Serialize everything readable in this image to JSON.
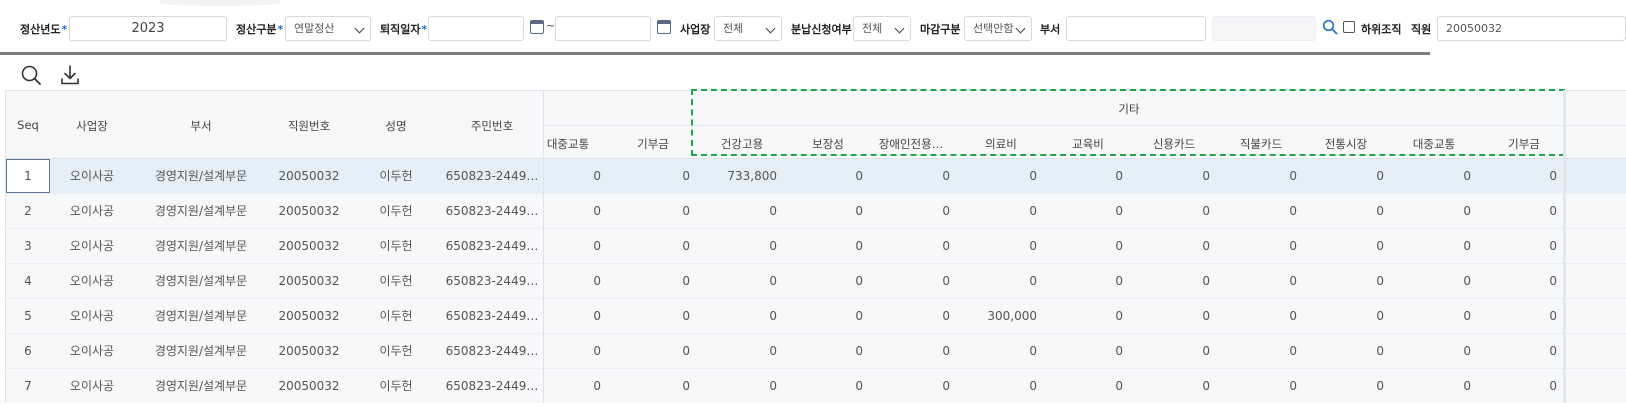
{
  "filters": {
    "year_label": "정산년도",
    "year_value": "2023",
    "settle_type_label": "정산구분",
    "settle_type_value": "연말정산",
    "retire_date_label": "퇴직일자",
    "retire_from": "",
    "range_sep": "~",
    "retire_to": "",
    "workplace_label": "사업장",
    "workplace_value": "전체",
    "installment_label": "분납신청여부",
    "installment_value": "전체",
    "closing_label": "마감구분",
    "closing_value": "선택안함",
    "dept_label": "부서",
    "dept_value": "",
    "dept_code": "",
    "sub_org_label": "하위조직",
    "employee_label": "직원",
    "employee_value": "20050032",
    "required_mark": "*"
  },
  "grid": {
    "fixed_headers": [
      "Seq",
      "사업장",
      "부서",
      "직원번호",
      "성명",
      "주민번호"
    ],
    "pre_headers": [
      "대중교통",
      "기부금"
    ],
    "group_label": "기타",
    "group_headers": [
      "건강고용",
      "보장성",
      "장애인전용…",
      "의료비",
      "교육비",
      "신용카드",
      "직불카드",
      "전통시장",
      "대중교통",
      "기부금"
    ],
    "rows": [
      {
        "seq": "1",
        "workplace": "오이사공",
        "dept": "경영지원/설계부문",
        "emp_no": "20050032",
        "name": "이두헌",
        "rrn": "650823-2449…",
        "values": [
          "0",
          "0",
          "733,800",
          "0",
          "0",
          "0",
          "0",
          "0",
          "0",
          "0",
          "0",
          "0"
        ]
      },
      {
        "seq": "2",
        "workplace": "오이사공",
        "dept": "경영지원/설계부문",
        "emp_no": "20050032",
        "name": "이두헌",
        "rrn": "650823-2449…",
        "values": [
          "0",
          "0",
          "0",
          "0",
          "0",
          "0",
          "0",
          "0",
          "0",
          "0",
          "0",
          "0"
        ]
      },
      {
        "seq": "3",
        "workplace": "오이사공",
        "dept": "경영지원/설계부문",
        "emp_no": "20050032",
        "name": "이두헌",
        "rrn": "650823-2449…",
        "values": [
          "0",
          "0",
          "0",
          "0",
          "0",
          "0",
          "0",
          "0",
          "0",
          "0",
          "0",
          "0"
        ]
      },
      {
        "seq": "4",
        "workplace": "오이사공",
        "dept": "경영지원/설계부문",
        "emp_no": "20050032",
        "name": "이두헌",
        "rrn": "650823-2449…",
        "values": [
          "0",
          "0",
          "0",
          "0",
          "0",
          "0",
          "0",
          "0",
          "0",
          "0",
          "0",
          "0"
        ]
      },
      {
        "seq": "5",
        "workplace": "오이사공",
        "dept": "경영지원/설계부문",
        "emp_no": "20050032",
        "name": "이두헌",
        "rrn": "650823-2449…",
        "values": [
          "0",
          "0",
          "0",
          "0",
          "0",
          "300,000",
          "0",
          "0",
          "0",
          "0",
          "0",
          "0"
        ]
      },
      {
        "seq": "6",
        "workplace": "오이사공",
        "dept": "경영지원/설계부문",
        "emp_no": "20050032",
        "name": "이두헌",
        "rrn": "650823-2449…",
        "values": [
          "0",
          "0",
          "0",
          "0",
          "0",
          "0",
          "0",
          "0",
          "0",
          "0",
          "0",
          "0"
        ]
      },
      {
        "seq": "7",
        "workplace": "오이사공",
        "dept": "경영지원/설계부문",
        "emp_no": "20050032",
        "name": "이두헌",
        "rrn": "650823-2449…",
        "values": [
          "0",
          "0",
          "0",
          "0",
          "0",
          "0",
          "0",
          "0",
          "0",
          "0",
          "0",
          "0"
        ]
      }
    ]
  },
  "colors": {
    "accent": "#1f6fdc",
    "highlight_box": "#1aa84a",
    "selected_row": "#e5eff7"
  },
  "icons": [
    "search-icon",
    "download-icon",
    "calendar-icon",
    "chevron-down-icon",
    "checkbox-icon"
  ]
}
